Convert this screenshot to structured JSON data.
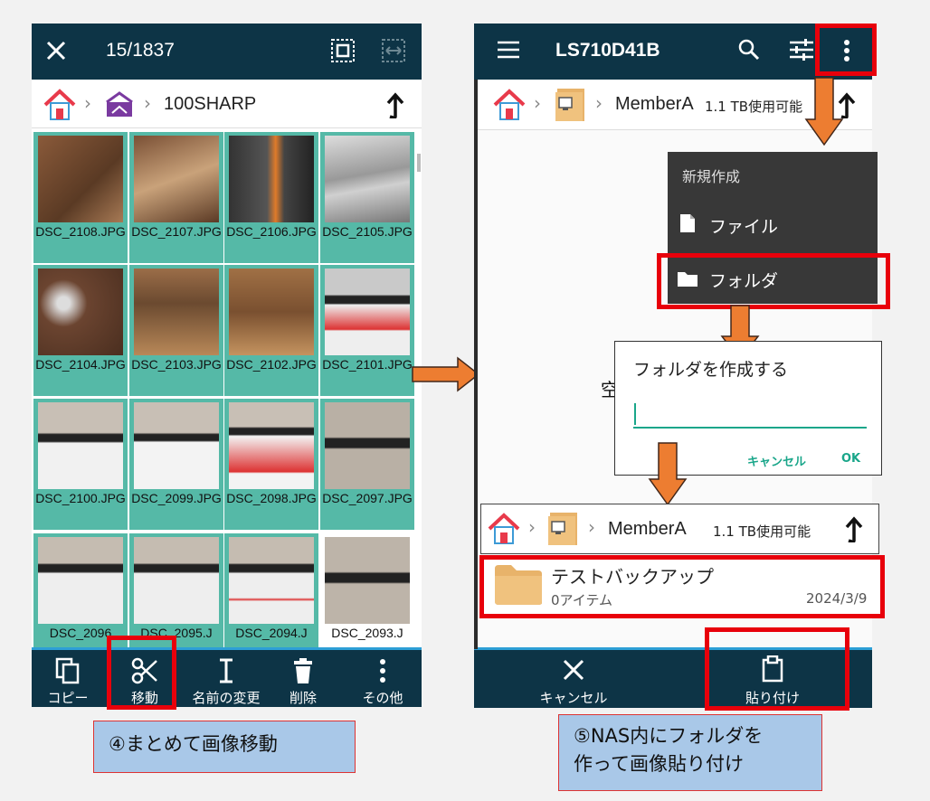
{
  "left_phone": {
    "header": {
      "counter": "15/1837"
    },
    "breadcrumb": {
      "folder": "100SHARP"
    },
    "files": [
      {
        "name": "DSC_2108.JPG"
      },
      {
        "name": "DSC_2107.JPG"
      },
      {
        "name": "DSC_2106.JPG"
      },
      {
        "name": "DSC_2105.JPG"
      },
      {
        "name": "DSC_2104.JPG"
      },
      {
        "name": "DSC_2103.JPG"
      },
      {
        "name": "DSC_2102.JPG"
      },
      {
        "name": "DSC_2101.JPG"
      },
      {
        "name": "DSC_2100.JPG"
      },
      {
        "name": "DSC_2099.JPG"
      },
      {
        "name": "DSC_2098.JPG"
      },
      {
        "name": "DSC_2097.JPG"
      },
      {
        "name": "DSC_2096"
      },
      {
        "name": "DSC_2095.J"
      },
      {
        "name": "DSC_2094.J"
      },
      {
        "name": "DSC_2093.J"
      }
    ],
    "actions": {
      "copy": "コピー",
      "move": "移動",
      "rename": "名前の変更",
      "delete": "削除",
      "more": "その他"
    }
  },
  "right_phone": {
    "header": {
      "title": "LS710D41B"
    },
    "breadcrumb": {
      "folder": "MemberA",
      "capacity": "1.1 TB使用可能"
    },
    "menu": {
      "header": "新規作成",
      "file": "ファイル",
      "folder": "フォルダ"
    },
    "dialog": {
      "title": "フォルダを作成する",
      "input_value": "",
      "cancel": "キャンセル",
      "ok": "OK"
    },
    "behind_text": "空",
    "result": {
      "folder": "MemberA",
      "capacity": "1.1 TB使用可能",
      "item_name": "テストバックアップ",
      "item_count": "0アイテム",
      "item_date": "2024/3/9"
    },
    "actions": {
      "cancel": "キャンセル",
      "paste": "貼り付け"
    }
  },
  "notes": {
    "step4": "④まとめて画像移動",
    "step5_line1": "⑤NAS内にフォルダを",
    "step5_line2": "作って画像貼り付け"
  },
  "colors": {
    "bar": "#0d3446",
    "selected": "#55b9a7",
    "highlight": "#e8000b",
    "arrow": "#ed7d31",
    "note": "#a9c8e8",
    "accent": "#1aa68a"
  }
}
